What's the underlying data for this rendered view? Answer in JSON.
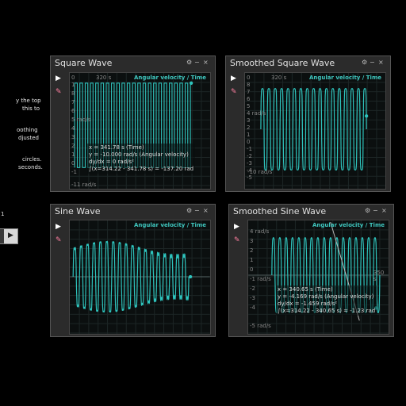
{
  "side_panel": {
    "lines": [
      "y the top",
      "this to",
      "oothing",
      "djusted",
      "circles.",
      "seconds."
    ],
    "number": "1"
  },
  "colors": {
    "signal": "#2ec4bd",
    "background": "#000000",
    "window": "#2b2b2b",
    "header": "#3fc8c0"
  },
  "windows": {
    "square": {
      "title": "Square Wave",
      "header": "Angular velocity / Time",
      "x_tick0": "0",
      "x_tick1": "320 s",
      "y_labels": [
        "1",
        "8",
        "7",
        "6",
        "5 rad/s",
        "4",
        "3",
        "2",
        "1",
        "0",
        "-1"
      ],
      "bottom_label": "-11 rad/s",
      "readout": [
        "x = 341.78 s (Time)",
        "y = -10.000 rad/s (Angular velocity)",
        "dy/dx = 0 rad/s²",
        "∫(x=314.22 - 341.78 s) = -137.20 rad"
      ]
    },
    "smoothed_square": {
      "title": "Smoothed Square Wave",
      "header": "Angular velocity / Time",
      "x_tick0": "0",
      "x_tick1": "320 s",
      "y_labels": [
        "8",
        "7",
        "6",
        "5",
        "4 rad/s",
        "3",
        "2",
        "1",
        "0",
        "-1",
        "-2",
        "-3",
        "-4",
        "-5"
      ],
      "bottom_label": "-10 rad/s"
    },
    "sine": {
      "title": "Sine Wave",
      "header": "Angular velocity / Time"
    },
    "smoothed_sine": {
      "title": "Smoothed Sine Wave",
      "header": "Angular velocity / Time",
      "y_labels": [
        "4 rad/s",
        "3",
        "2",
        "1",
        "0",
        "-1 rad/s",
        "-2",
        "-3",
        "-4"
      ],
      "x_tick1": "350 s",
      "bottom_label": "-5 rad/s",
      "readout": [
        "x = 340.65 s (Time)",
        "y = -4.169 rad/s (Angular velocity)",
        "dy/dx = -1.459 rad/s²",
        "∫(x=314.22 - 340.65 s) = -1.23 rad"
      ]
    }
  },
  "window_controls": [
    "⚙",
    "−",
    "×"
  ],
  "tools": {
    "play": "▶",
    "pen": "✎"
  }
}
